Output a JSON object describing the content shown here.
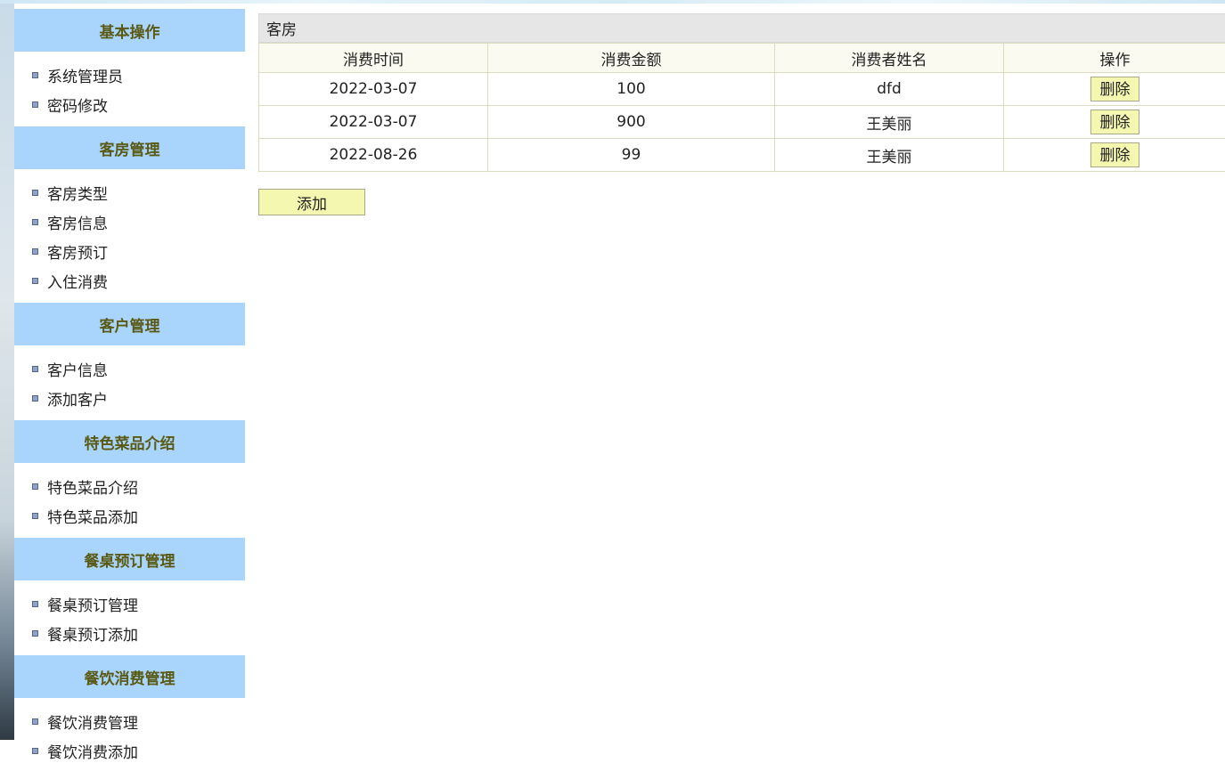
{
  "sidebar": {
    "sections": [
      {
        "title": "基本操作",
        "items": [
          "系统管理员",
          "密码修改"
        ]
      },
      {
        "title": "客房管理",
        "items": [
          "客房类型",
          "客房信息",
          "客房预订",
          "入住消费"
        ]
      },
      {
        "title": "客户管理",
        "items": [
          "客户信息",
          "添加客户"
        ]
      },
      {
        "title": "特色菜品介绍",
        "items": [
          "特色菜品介绍",
          "特色菜品添加"
        ]
      },
      {
        "title": "餐桌预订管理",
        "items": [
          "餐桌预订管理",
          "餐桌预订添加"
        ]
      },
      {
        "title": "餐饮消费管理",
        "items": [
          "餐饮消费管理",
          "餐饮消费添加"
        ]
      }
    ]
  },
  "main": {
    "caption": "客房",
    "columns": [
      "消费时间",
      "消费金额",
      "消费者姓名",
      "操作"
    ],
    "rows": [
      {
        "time": "2022-03-07",
        "amount": "100",
        "name": "dfd",
        "action": "删除"
      },
      {
        "time": "2022-03-07",
        "amount": "900",
        "name": "王美丽",
        "action": "删除"
      },
      {
        "time": "2022-08-26",
        "amount": "99",
        "name": "王美丽",
        "action": "删除"
      }
    ],
    "add_label": "添加"
  },
  "colors": {
    "section_header_bg": "#a9d4fb",
    "section_header_text": "#5a5a14",
    "button_bg": "#f3f7b0",
    "caption_bg": "#e6e6e6"
  }
}
